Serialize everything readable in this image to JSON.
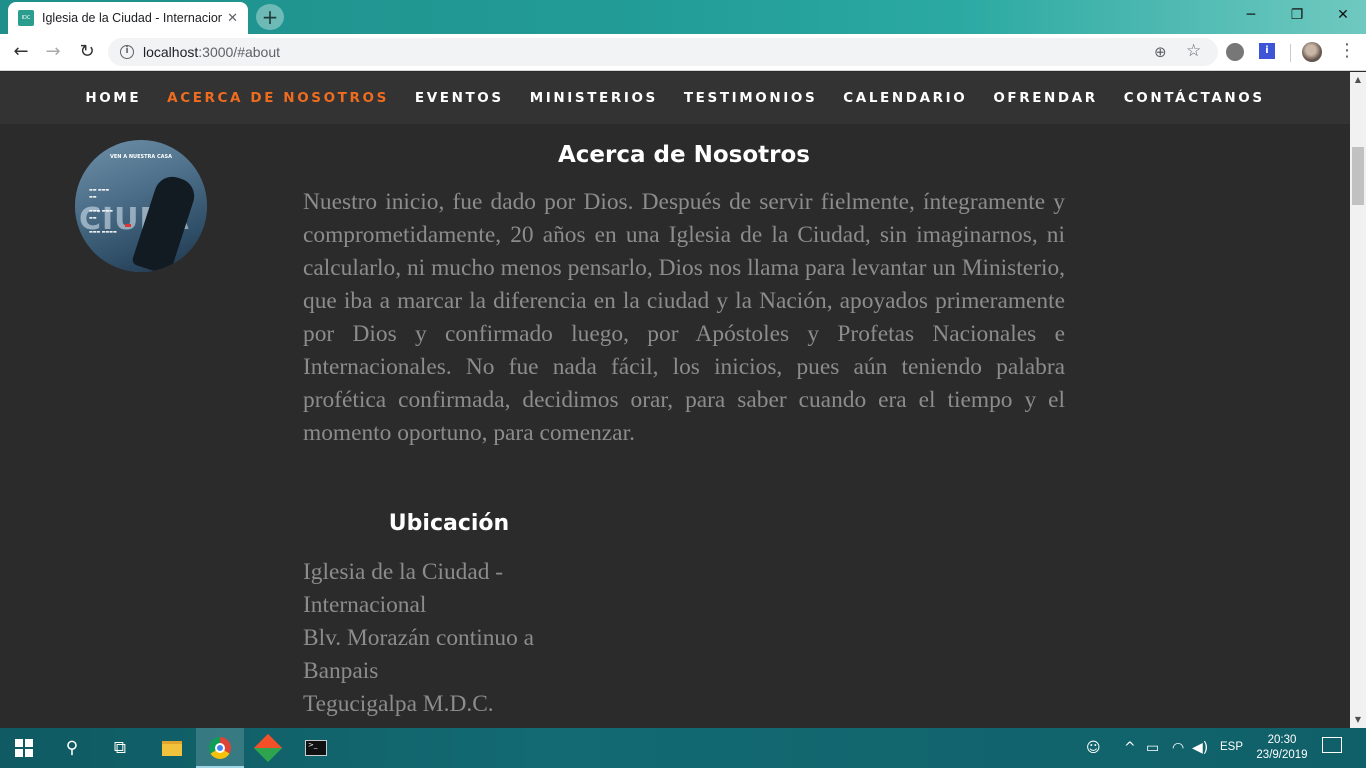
{
  "browser": {
    "tab": {
      "title": "Iglesia de la Ciudad - Internacional",
      "close_glyph": "✕",
      "favicon": "site-favicon-icon"
    },
    "new_tab_glyph": "+",
    "window_controls": {
      "minimize": "─",
      "maximize": "❐",
      "close": "✕"
    },
    "nav": {
      "back": "←",
      "forward": "→",
      "reload": "↻"
    },
    "address": {
      "host": "localhost",
      "rest": ":3000/#about"
    },
    "toolbar_icons": {
      "zoom": "⊕",
      "star": "☆",
      "ext2_label": "i",
      "menu": "⋮"
    }
  },
  "site": {
    "nav_items": [
      {
        "label": "HOME",
        "active": false
      },
      {
        "label": "ACERCA DE NOSOTROS",
        "active": true
      },
      {
        "label": "EVENTOS",
        "active": false
      },
      {
        "label": "MINISTERIOS",
        "active": false
      },
      {
        "label": "TESTIMONIOS",
        "active": false
      },
      {
        "label": "CALENDARIO",
        "active": false
      },
      {
        "label": "OFRENDAR",
        "active": false
      },
      {
        "label": "CONTÁCTANOS",
        "active": false
      }
    ],
    "accent_color": "#ef6c1f",
    "logo": {
      "header": "VEN A NUESTRA CASA",
      "word": "CIUDA"
    },
    "about": {
      "title": "Acerca de Nosotros",
      "text": "Nuestro inicio, fue dado por Dios. Después de servir fielmente, íntegramente y comprometidamente, 20 años en una Iglesia de la Ciudad, sin imaginarnos, ni calcularlo, ni mucho menos pensarlo, Dios nos llama para levantar un Ministerio, que iba a marcar la diferencia en la ciudad y la Nación, apoyados primeramente por Dios y confirmado luego, por Apóstoles y Profetas Nacionales e Internacionales. No fue nada fácil, los inicios, pues aún teniendo palabra profética confirmada, decidimos orar, para saber cuando era el tiempo y el momento oportuno, para comenzar."
    },
    "location": {
      "title": "Ubicación",
      "lines": [
        "Iglesia de la Ciudad -\nInternacional",
        "Blv. Morazán continuo a\nBanpais",
        "Tegucigalpa M.D.C."
      ]
    }
  },
  "scrollbar": {
    "up": "▲",
    "down": "▼"
  },
  "taskbar": {
    "search_glyph": "⚲",
    "taskview_glyph": "⧉",
    "tray": {
      "people": "☺",
      "chevron": "^",
      "battery": "▭",
      "wifi": "◠",
      "volume": "◀)"
    },
    "language": "ESP",
    "time": "20:30",
    "date": "23/9/2019"
  }
}
